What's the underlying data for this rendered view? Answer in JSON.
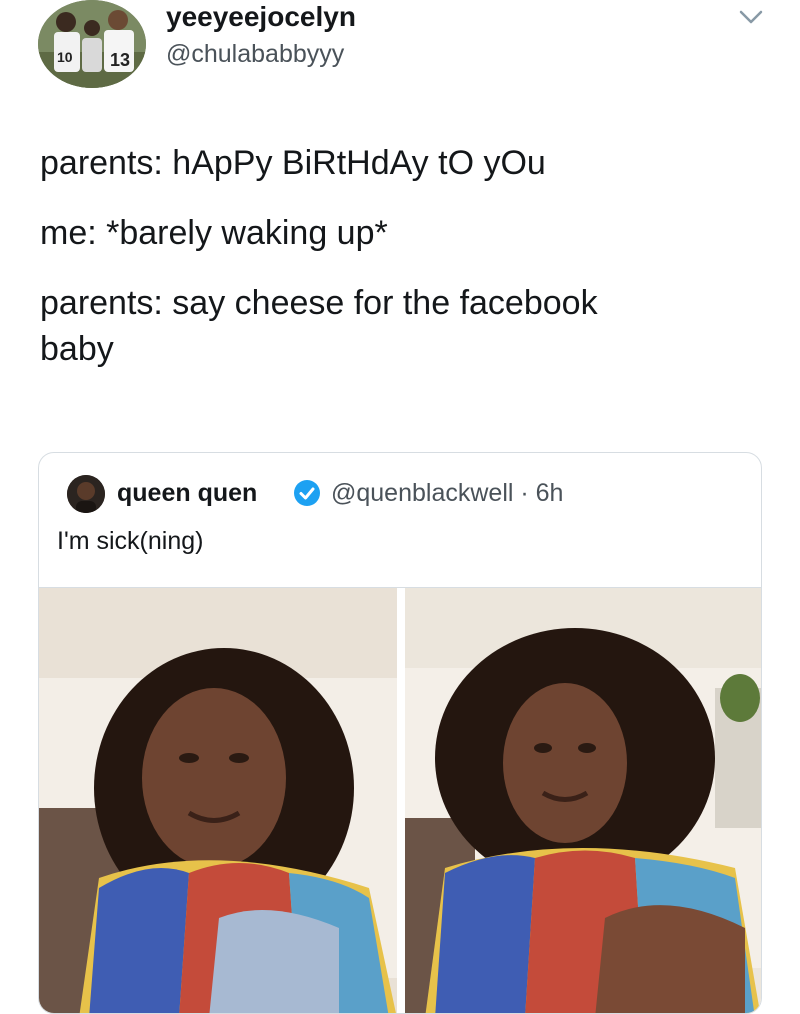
{
  "author": {
    "display_name": "yeeyeejocelyn",
    "handle": "@chulababbyyy",
    "avatar_icon": "group-photo-avatar"
  },
  "menu_icon": "chevron-down-icon",
  "tweet": {
    "lines": [
      "parents: hApPy BiRtHdAy tO yOu",
      "me: *barely waking up*",
      "parents: say cheese for the facebook",
      "baby"
    ]
  },
  "quoted_tweet": {
    "display_name": "queen quen",
    "verified_icon": "verified-badge-icon",
    "handle_time": "@quenblackwell · 6h",
    "text": "I'm sick(ning)",
    "photos": [
      {
        "name": "selfie-photo-1"
      },
      {
        "name": "selfie-photo-2"
      }
    ]
  },
  "colors": {
    "text": "#14171a",
    "secondary_text": "#4a5259",
    "border": "#d7dde2",
    "verified": "#1da1f2"
  }
}
